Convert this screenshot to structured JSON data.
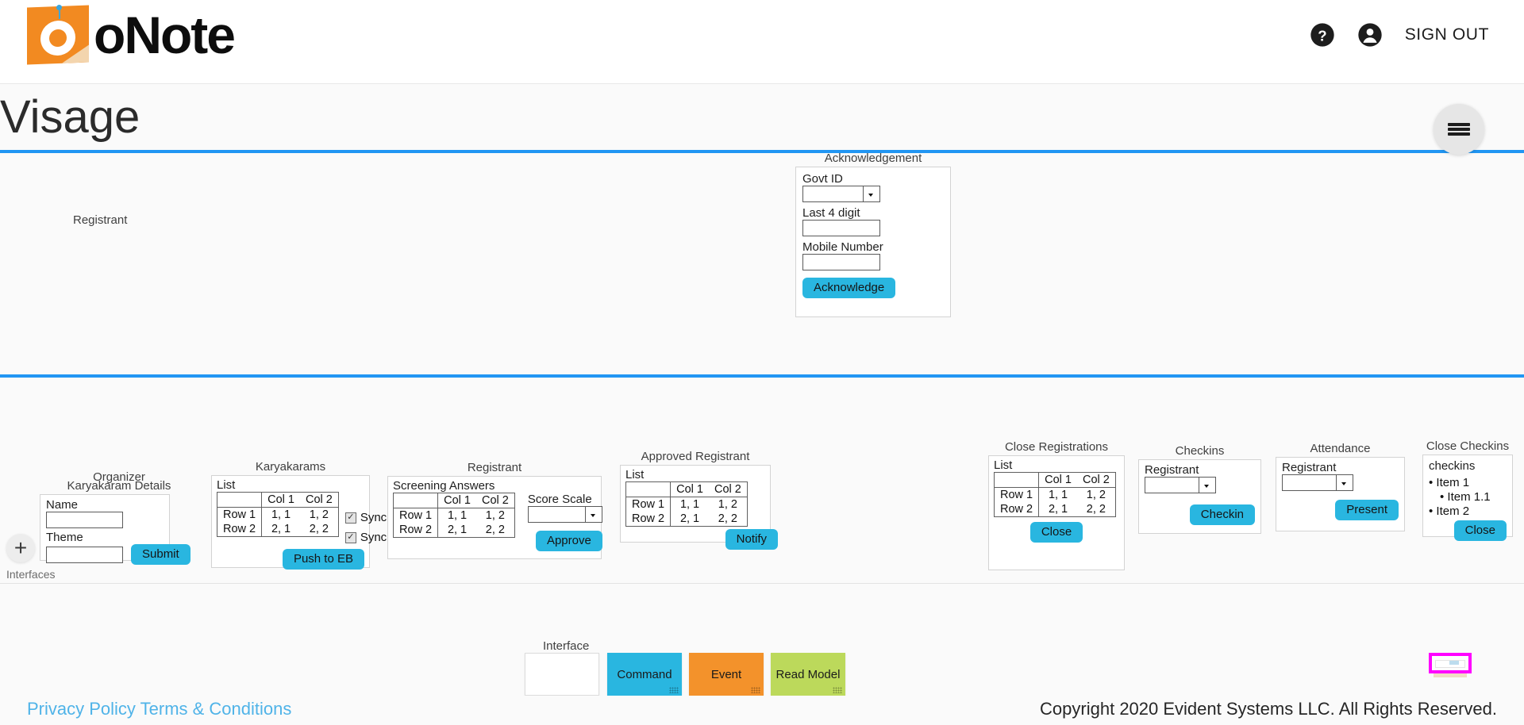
{
  "brand": {
    "name": "oNote",
    "logo_icon": "onote-logo-icon"
  },
  "header": {
    "help_icon": "help-circle-icon",
    "account_icon": "account-circle-icon",
    "sign_out": "SIGN OUT",
    "menu_icon": "hamburger-menu-icon"
  },
  "page": {
    "title": "Visage"
  },
  "upper_row": {
    "registrant_label": "Registrant",
    "acknowledgement": {
      "caption": "Acknowledgement",
      "govt_id_label": "Govt ID",
      "govt_id_value": "",
      "last4_label": "Last 4 digit",
      "last4_value": "",
      "mobile_label": "Mobile Number",
      "mobile_value": "",
      "button": "Acknowledge"
    }
  },
  "lower_row": {
    "interfaces_label": "Interfaces",
    "add_icon": "plus-icon",
    "organizer": {
      "caption_top": "Organizer",
      "caption": "Karyakaram Details",
      "name_label": "Name",
      "name_value": "",
      "theme_label": "Theme",
      "theme_value": "",
      "button": "Submit"
    },
    "karyakarams": {
      "caption": "Karyakarams",
      "list_label": "List",
      "table": {
        "columns": [
          "",
          "Col 1",
          "Col 2"
        ],
        "rows": [
          {
            "header": "Row 1",
            "cells": [
              "1, 1",
              "1, 2"
            ]
          },
          {
            "header": "Row 2",
            "cells": [
              "2, 1",
              "2, 2"
            ]
          }
        ]
      },
      "checkboxes": [
        {
          "label": "Sync",
          "checked": true
        },
        {
          "label": "Sync",
          "checked": true
        }
      ],
      "button": "Push to EB"
    },
    "registrant": {
      "caption": "Registrant",
      "screening_label": "Screening Answers",
      "table": {
        "columns": [
          "",
          "Col 1",
          "Col 2"
        ],
        "rows": [
          {
            "header": "Row 1",
            "cells": [
              "1, 1",
              "1, 2"
            ]
          },
          {
            "header": "Row 2",
            "cells": [
              "2, 1",
              "2, 2"
            ]
          }
        ]
      },
      "score_scale_label": "Score Scale",
      "score_scale_value": "",
      "button": "Approve"
    },
    "approved_registrant": {
      "caption": "Approved Registrant",
      "list_label": "List",
      "table": {
        "columns": [
          "",
          "Col 1",
          "Col 2"
        ],
        "rows": [
          {
            "header": "Row 1",
            "cells": [
              "1, 1",
              "1, 2"
            ]
          },
          {
            "header": "Row 2",
            "cells": [
              "2, 1",
              "2, 2"
            ]
          }
        ]
      },
      "button": "Notify"
    },
    "close_registrations": {
      "caption": "Close Registrations",
      "list_label": "List",
      "table": {
        "columns": [
          "",
          "Col 1",
          "Col 2"
        ],
        "rows": [
          {
            "header": "Row 1",
            "cells": [
              "1, 1",
              "1, 2"
            ]
          },
          {
            "header": "Row 2",
            "cells": [
              "2, 1",
              "2, 2"
            ]
          }
        ]
      },
      "button": "Close"
    },
    "checkins": {
      "caption": "Checkins",
      "registrant_label": "Registrant",
      "registrant_value": "",
      "button": "Checkin"
    },
    "attendance": {
      "caption": "Attendance",
      "registrant_label": "Registrant",
      "registrant_value": "",
      "button": "Present"
    },
    "close_checkins": {
      "caption": "Close Checkins",
      "list_title": "checkins",
      "items": [
        "Item 1",
        "Item 1.1",
        "Item 2"
      ],
      "button": "Close"
    }
  },
  "palette": {
    "caption": "Interface",
    "blank_label": "",
    "blocks": [
      {
        "label": "Command",
        "color": "#29b6e0"
      },
      {
        "label": "Event",
        "color": "#f3922b"
      },
      {
        "label": "Read Model",
        "color": "#bcd95b"
      }
    ],
    "selected_outline_color": "#ff00ff"
  },
  "footer": {
    "links": "Privacy Policy Terms & Conditions",
    "copyright": "Copyright 2020 Evident Systems LLC. All Rights Reserved."
  }
}
